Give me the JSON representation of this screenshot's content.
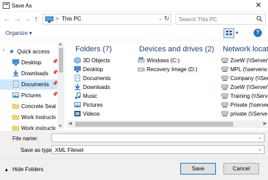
{
  "window": {
    "title": "Save As",
    "close_glyph": "✕"
  },
  "nav": {
    "back": "←",
    "forward": "→",
    "history": "⌄",
    "up": "↑"
  },
  "address": {
    "separator": ">",
    "location": "This PC",
    "dropdown": "⌄",
    "refresh": "↻"
  },
  "search": {
    "placeholder": "Search This PC"
  },
  "toolbar": {
    "organize_label": "Organize ▾",
    "view_dropdown": "▾",
    "help": "?"
  },
  "sidebar": {
    "quick_access_label": "Quick access",
    "items": [
      {
        "label": "Desktop",
        "icon": "desktop-icon",
        "pinned": true
      },
      {
        "label": "Downloads",
        "icon": "downloads-icon",
        "pinned": true
      },
      {
        "label": "Documents",
        "icon": "documents-icon",
        "pinned": true,
        "selected": true
      },
      {
        "label": "Pictures",
        "icon": "pictures-icon",
        "pinned": true
      },
      {
        "label": "Concrete Sealer",
        "icon": "folder-icon",
        "pinned": false
      },
      {
        "label": "Work Instruction",
        "icon": "folder-icon",
        "pinned": false
      },
      {
        "label": "Work instructio",
        "icon": "folder-icon",
        "pinned": false
      }
    ]
  },
  "content": {
    "folders": {
      "heading": "Folders (7)",
      "items": [
        "3D Objects",
        "Desktop",
        "Documents",
        "Downloads",
        "Music",
        "Pictures",
        "Videos"
      ]
    },
    "drives": {
      "heading": "Devices and drives (2)",
      "items": [
        "Windows (C:)",
        "Recovery Image (D:)"
      ]
    },
    "network": {
      "heading": "Network locatio",
      "items": [
        "ZoeW (\\\\Server\\",
        "MPL (\\\\serverw",
        "Company (\\\\Serv",
        "ZoeW (\\\\Server\\",
        "Training (\\\\Serv",
        "Private (\\\\server",
        "private (\\\\Serve"
      ]
    }
  },
  "form": {
    "file_name_label": "File name:",
    "file_name_value": "",
    "save_type_label": "Save as type:",
    "save_type_value": "XML Fileset"
  },
  "footer": {
    "hide_folders_label": "Hide Folders",
    "save_label": "Save",
    "cancel_label": "Cancel"
  },
  "colors": {
    "accent": "#0078d7",
    "heading": "#1e3f7a",
    "selected_bg": "#cce8ff"
  }
}
